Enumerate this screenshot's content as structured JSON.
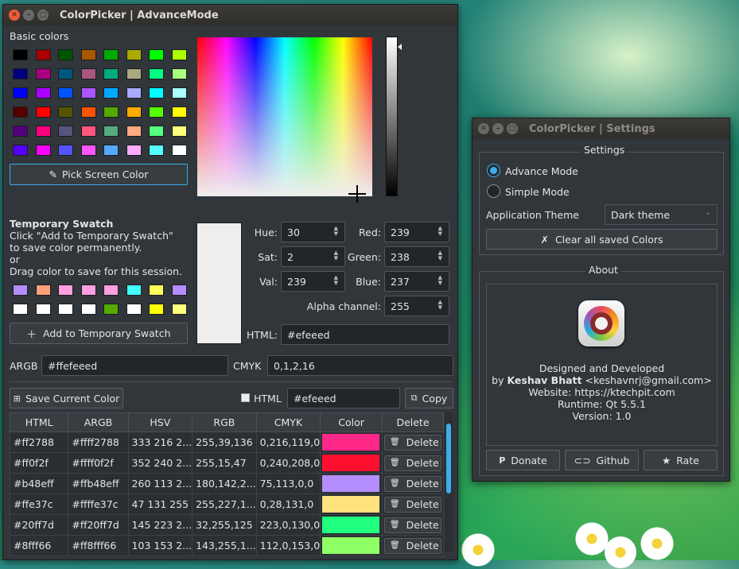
{
  "main_window": {
    "title": "ColorPicker | AdvanceMode",
    "basic_colors_label": "Basic colors",
    "basic_colors": [
      [
        "#000000",
        "#aa0000",
        "#005500",
        "#aa5500",
        "#00aa00",
        "#aaaa00",
        "#00ff00",
        "#aaff00"
      ],
      [
        "#00007f",
        "#aa007f",
        "#00557f",
        "#aa557f",
        "#00aa7f",
        "#aaaa7f",
        "#00ff7f",
        "#aaff7f"
      ],
      [
        "#0000ff",
        "#aa00ff",
        "#0055ff",
        "#aa55ff",
        "#00aaff",
        "#aaaaff",
        "#00ffff",
        "#aaffff"
      ],
      [
        "#550000",
        "#ff0000",
        "#555500",
        "#ff5500",
        "#55aa00",
        "#ffaa00",
        "#55ff00",
        "#ffff00"
      ],
      [
        "#55007f",
        "#ff007f",
        "#55557f",
        "#ff557f",
        "#55aa7f",
        "#ffaa7f",
        "#55ff7f",
        "#ffff7f"
      ],
      [
        "#5500ff",
        "#ff00ff",
        "#5555ff",
        "#ff55ff",
        "#55aaff",
        "#ffaaff",
        "#55ffff",
        "#ffffff"
      ]
    ],
    "pick_screen_color": "Pick Screen Color",
    "temporary_swatch_title": "Temporary Swatch",
    "temporary_swatch_lines": [
      "Click \"Add to Temporary Swatch\"",
      "to save color permanently.",
      "or",
      "Drag color to save for this session."
    ],
    "temp_swatch_colors": [
      [
        "#b48eff",
        "#ffa07a",
        "#ff9fe0",
        "#ff9fe0",
        "#ff9fe0",
        "#40ffff",
        "#ffff5a",
        "#b48eff"
      ],
      [
        "#ffffff",
        "#ffffff",
        "#ffffff",
        "#ffffff",
        "#55aa00",
        "#ffffff",
        "#ffff00",
        "#ffff7f"
      ]
    ],
    "add_temp_swatch": "Add to Temporary Swatch",
    "preview_color": "#efeeed",
    "hue_label": "Hue:",
    "hue": "30",
    "sat_label": "Sat:",
    "sat": "2",
    "val_label": "Val:",
    "val": "239",
    "red_label": "Red:",
    "red": "239",
    "green_label": "Green:",
    "green": "238",
    "blue_label": "Blue:",
    "blue": "237",
    "alpha_label": "Alpha channel:",
    "alpha": "255",
    "html_label": "HTML:",
    "html": "#efeeed",
    "argb_label": "ARGB",
    "argb": "#ffefeeed",
    "cmyk_label": "CMYK",
    "cmyk": "0,1,2,16",
    "save_current_color": "Save Current Color",
    "html_checkbox_label": "HTML",
    "html_save_field": "#efeeed",
    "copy_button": "Copy",
    "table_headers": [
      "HTML",
      "ARGB",
      "HSV",
      "RGB",
      "CMYK",
      "Color",
      "Delete"
    ],
    "rows": [
      {
        "html": "#ff2788",
        "argb": "#ffff2788",
        "hsv": "333 216 2...",
        "rgb": "255,39,136",
        "cmyk": "0,216,119,0",
        "color": "#ff2788",
        "delete": "Delete"
      },
      {
        "html": "#ff0f2f",
        "argb": "#ffff0f2f",
        "hsv": "352 240 2...",
        "rgb": "255,15,47",
        "cmyk": "0,240,208,0",
        "color": "#ff0f2f",
        "delete": "Delete"
      },
      {
        "html": "#b48eff",
        "argb": "#ffb48eff",
        "hsv": "260 113 2...",
        "rgb": "180,142,2...",
        "cmyk": "75,113,0,0",
        "color": "#b48eff",
        "delete": "Delete"
      },
      {
        "html": "#ffe37c",
        "argb": "#ffffe37c",
        "hsv": "47 131 255",
        "rgb": "255,227,1...",
        "cmyk": "0,28,131,0",
        "color": "#ffe37c",
        "delete": "Delete"
      },
      {
        "html": "#20ff7d",
        "argb": "#ff20ff7d",
        "hsv": "145 223 2...",
        "rgb": "32,255,125",
        "cmyk": "223,0,130,0",
        "color": "#20ff7d",
        "delete": "Delete"
      },
      {
        "html": "#8fff66",
        "argb": "#ff8fff66",
        "hsv": "103 153 2...",
        "rgb": "143,255,1...",
        "cmyk": "112,0,153,0",
        "color": "#8fff66",
        "delete": "Delete"
      }
    ]
  },
  "settings_window": {
    "title": "ColorPicker | Settings",
    "settings_group": "Settings",
    "advance_mode": "Advance Mode",
    "simple_mode": "Simple Mode",
    "app_theme_label": "Application Theme",
    "app_theme_value": "Dark theme",
    "clear_colors": "Clear all saved Colors",
    "about_group": "About",
    "designed": "Designed and Developed",
    "by_prefix": "by",
    "author": "Keshav Bhatt",
    "email": "<keshavnrj@gmail.com>",
    "website": "Website: https://ktechpit.com",
    "runtime": "Runtime: Qt 5.5.1",
    "version": "Version: 1.0",
    "donate": "Donate",
    "github": "Github",
    "rate": "Rate"
  },
  "colors": {
    "accent": "#3daee9",
    "window_bg": "#31363b",
    "field_bg": "#232629"
  }
}
